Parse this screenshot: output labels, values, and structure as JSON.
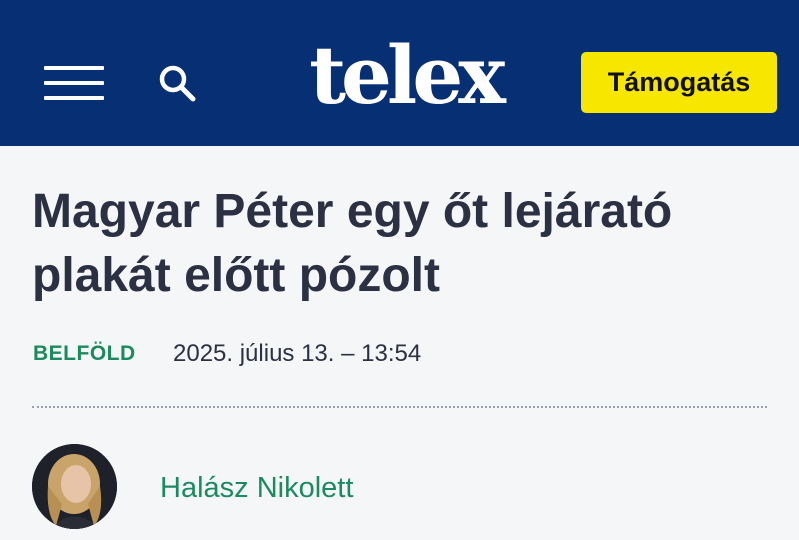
{
  "header": {
    "logo": "telex",
    "support_label": "Támogatás",
    "menu_icon": "hamburger-menu-icon",
    "search_icon": "search-icon",
    "background": "#062f74",
    "support_color": "#f6e600"
  },
  "article": {
    "title": "Magyar Péter egy őt lejárató plakát előtt pózolt",
    "category": "BELFÖLD",
    "date": "2025. július 13. – 13:54",
    "author": "Halász Nikolett",
    "accent": "#1c8a5f"
  }
}
